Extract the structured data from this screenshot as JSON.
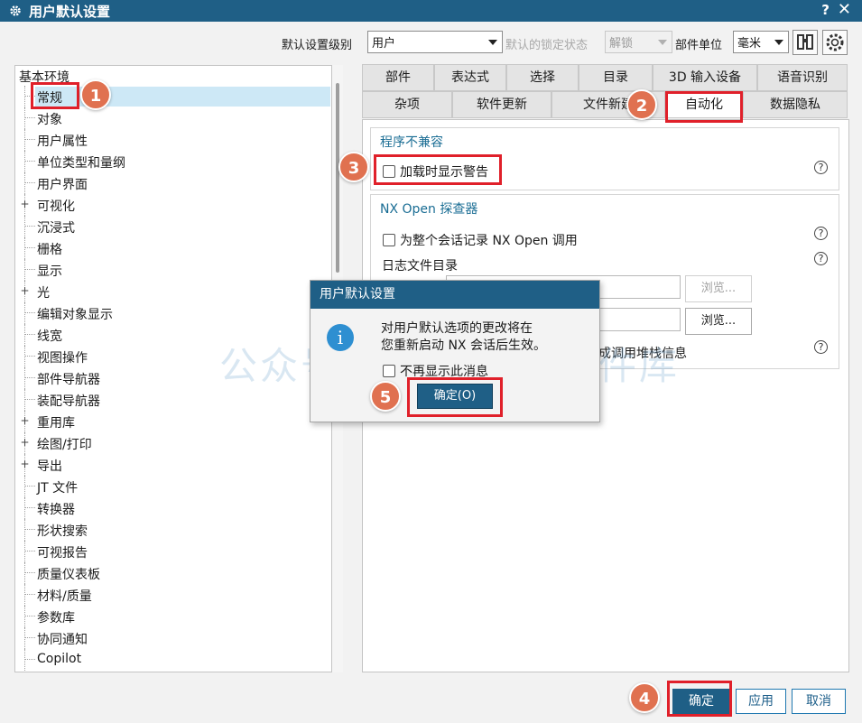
{
  "window": {
    "title": "用户默认设置",
    "help": "?",
    "close": "✕"
  },
  "toolbar": {
    "level_label": "默认设置级别",
    "level_value": "用户",
    "lock_label": "默认的锁定状态",
    "lock_value": "解锁",
    "unit_label": "部件单位",
    "unit_value": "毫米"
  },
  "tree": {
    "root": "基本环境",
    "items": [
      "常规",
      "对象",
      "用户属性",
      "单位类型和量纲",
      "用户界面",
      "可视化",
      "沉浸式",
      "栅格",
      "显示",
      "光",
      "编辑对象显示",
      "线宽",
      "视图操作",
      "部件导航器",
      "装配导航器",
      "重用库",
      "绘图/打印",
      "导出",
      "JT 文件",
      "转换器",
      "形状搜索",
      "可视报告",
      "质量仪表板",
      "材料/质量",
      "参数库",
      "协同通知",
      "Copilot"
    ],
    "expand_marker": "+"
  },
  "tabs": {
    "row1": [
      "部件",
      "表达式",
      "选择",
      "目录",
      "3D 输入设备",
      "语音识别"
    ],
    "row2": [
      "杂项",
      "软件更新",
      "文件新建",
      "自动化",
      "数据隐私"
    ]
  },
  "content": {
    "group1_title": "程序不兼容",
    "group1_check": "加载时显示警告",
    "group2_title": "NX Open 探查器",
    "group2_check": "为整个会话记录 NX Open 调用",
    "log_dir_label": "日志文件目录",
    "browse_label": "浏览...",
    "stack_text": "成调用堆栈信息",
    "help_glyph": "?"
  },
  "dialog": {
    "title": "用户默认设置",
    "info_glyph": "i",
    "message_line1": "对用户默认选项的更改将在",
    "message_line2": "您重新启动 NX 会话后生效。",
    "check_label": "不再显示此消息",
    "ok_label": "确定(O)"
  },
  "buttons": {
    "ok": "确定",
    "apply": "应用",
    "cancel": "取消"
  },
  "badges": [
    "1",
    "2",
    "3",
    "4",
    "5"
  ],
  "watermark": "公众号：",
  "watermark_tail": "雷软件库",
  "colors": {
    "titlebar": "#1f5f86",
    "annotation": "#e0202a",
    "badge": "#e07150",
    "link": "#1a6d94"
  }
}
